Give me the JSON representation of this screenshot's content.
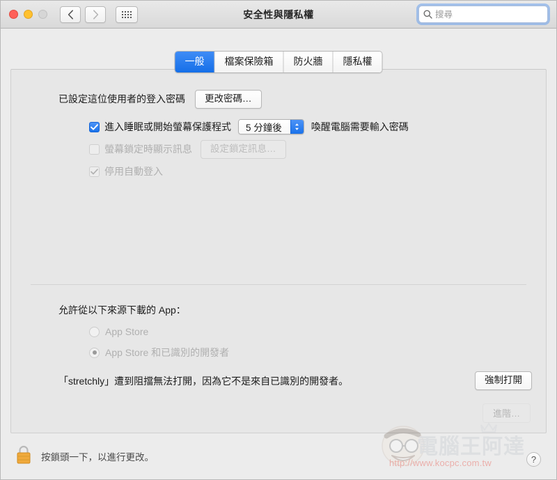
{
  "window": {
    "title": "安全性與隱私權",
    "traffic_lights": [
      "close",
      "minimize",
      "zoom"
    ],
    "nav": {
      "back_label": "‹",
      "forward_label": "›",
      "grid_label": "show-all"
    }
  },
  "search": {
    "placeholder": "搜尋",
    "value": "",
    "icon": "search-icon"
  },
  "tabs": [
    {
      "label": "一般",
      "active": true
    },
    {
      "label": "檔案保險箱",
      "active": false
    },
    {
      "label": "防火牆",
      "active": false
    },
    {
      "label": "隱私權",
      "active": false
    }
  ],
  "general": {
    "password_set_label": "已設定這位使用者的登入密碼",
    "change_password_button": "更改密碼…",
    "require_password": {
      "checked": true,
      "enabled": true,
      "label": "進入睡眠或開始螢幕保護程式",
      "delay_value": "5 分鐘後",
      "suffix_label": "喚醒電腦需要輸入密碼"
    },
    "show_message": {
      "checked": false,
      "enabled": false,
      "label": "螢幕鎖定時顯示訊息",
      "set_message_button": "設定鎖定訊息…"
    },
    "disable_auto_login": {
      "checked": true,
      "enabled": false,
      "label": "停用自動登入"
    }
  },
  "gatekeeper": {
    "heading": "允許從以下來源下載的 App：",
    "options": [
      {
        "label": "App Store",
        "selected": false,
        "enabled": false
      },
      {
        "label": "App Store 和已識別的開發者",
        "selected": true,
        "enabled": false
      }
    ],
    "blocked_message": "「stretchly」遭到阻擋無法打開，因為它不是來自已識別的開發者。",
    "open_anyway_button": "強制打開"
  },
  "footer": {
    "lock_icon": "lock-closed-icon",
    "lock_note": "按鎖頭一下，以進行更改。",
    "advanced_button": "進階…",
    "help_button": "?"
  },
  "watermark": {
    "brand": "電腦王阿達",
    "url": "http://www.kocpc.com.tw"
  },
  "colors": {
    "accent": "#1a72ea",
    "window_bg": "#ececec",
    "panel_bg": "#e7e7e7",
    "lock_gold": "#f0a93b",
    "watermark_red": "#e8493c"
  }
}
